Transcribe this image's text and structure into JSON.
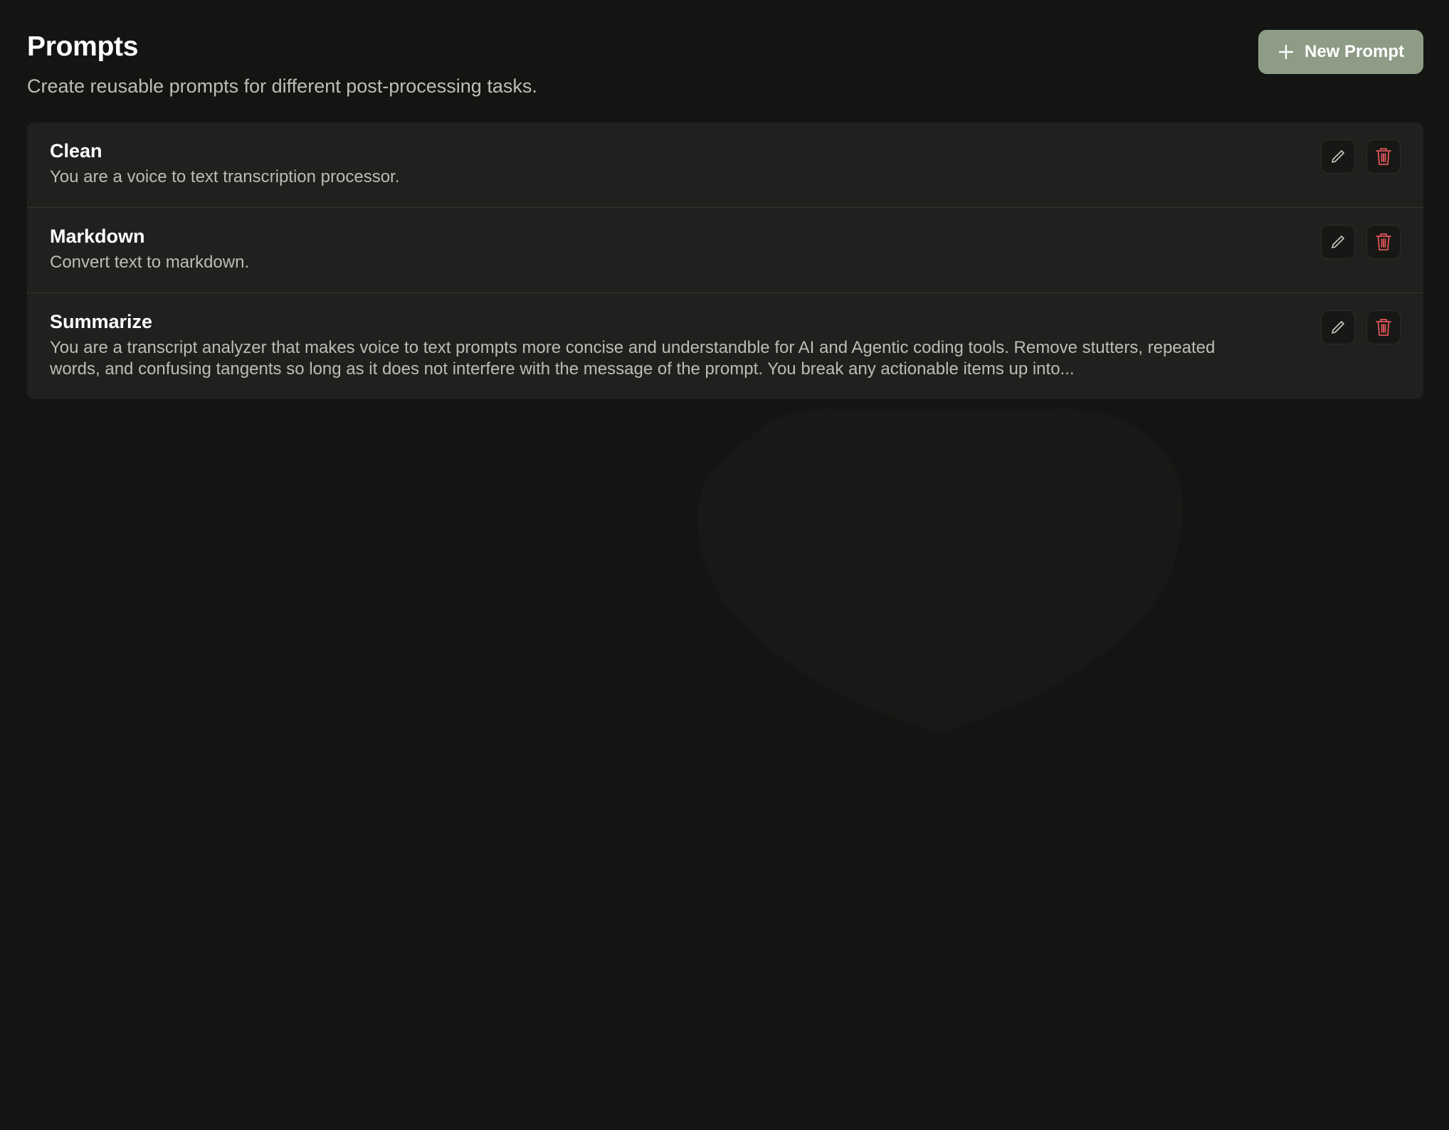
{
  "header": {
    "title": "Prompts",
    "subtitle": "Create reusable prompts for different post-processing tasks.",
    "new_button_label": "New Prompt",
    "new_button_icon": "plus-icon"
  },
  "prompts": [
    {
      "title": "Clean",
      "description": "You are a voice to text transcription processor.",
      "edit_icon": "pencil-icon",
      "delete_icon": "trash-icon"
    },
    {
      "title": "Markdown",
      "description": "Convert text to markdown.",
      "edit_icon": "pencil-icon",
      "delete_icon": "trash-icon"
    },
    {
      "title": "Summarize",
      "description": "You are a transcript analyzer that makes voice to text prompts more concise and understandble for AI and Agentic coding tools. Remove stutters, repeated words, and confusing tangents so long as it does not interfere with the message of the prompt. You break any actionable items up into...",
      "edit_icon": "pencil-icon",
      "delete_icon": "trash-icon"
    }
  ],
  "colors": {
    "background": "#141512",
    "card": "#20211e",
    "accent_button": "#8e9c86",
    "delete_icon": "#e0555a",
    "edit_icon": "#c8c8c4"
  }
}
